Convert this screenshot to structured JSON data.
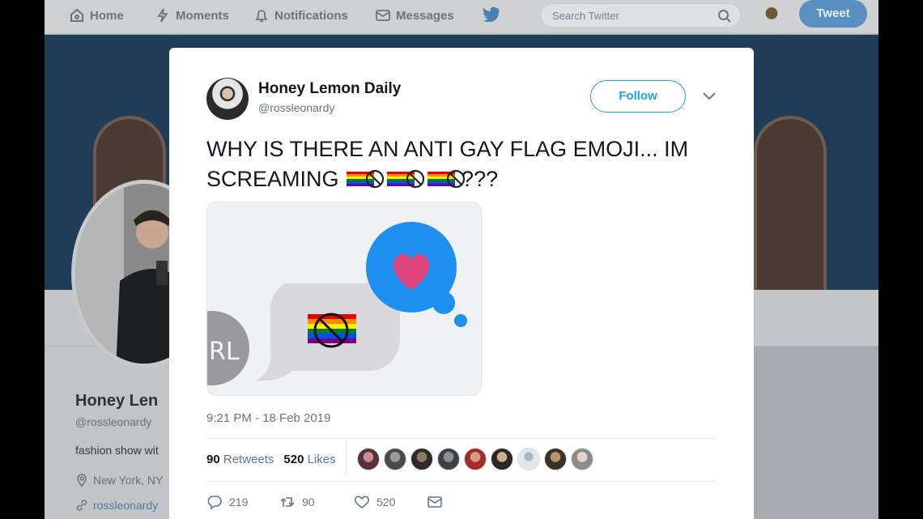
{
  "nav": {
    "home": "Home",
    "moments": "Moments",
    "notifications": "Notifications",
    "messages": "Messages",
    "search_placeholder": "Search Twitter",
    "tweet_button": "Tweet"
  },
  "background_profile": {
    "name": "Honey Len",
    "handle": "@rossleonardy",
    "bio": "fashion show wit",
    "location": "New York, NY",
    "link": "rossleonardy"
  },
  "tweet": {
    "author_name": "Honey Lemon Daily",
    "author_handle": "@rossleonardy",
    "follow_label": "Follow",
    "text_line1": "WHY IS THERE AN ANTI GAY FLAG EMOJI... IM",
    "text_line2_prefix": "SCREAMING",
    "text_line2_suffix": "???",
    "media_bubble_initials": "RL",
    "timestamp": "9:21 PM - 18 Feb 2019",
    "retweets_count": "90",
    "retweets_label": "Retweets",
    "likes_count": "520",
    "likes_label": "Likes",
    "reply_count": "219",
    "retweet_action_count": "90",
    "like_action_count": "520"
  },
  "colors": {
    "twitter_blue": "#1da1f2",
    "heart_pink": "#e0457b"
  },
  "icons": [
    "home-icon",
    "moments-icon",
    "notifications-icon",
    "messages-icon",
    "twitter-bird-icon",
    "search-icon",
    "chevron-down-icon",
    "reply-icon",
    "retweet-icon",
    "like-icon",
    "dm-icon",
    "location-icon",
    "link-icon"
  ]
}
